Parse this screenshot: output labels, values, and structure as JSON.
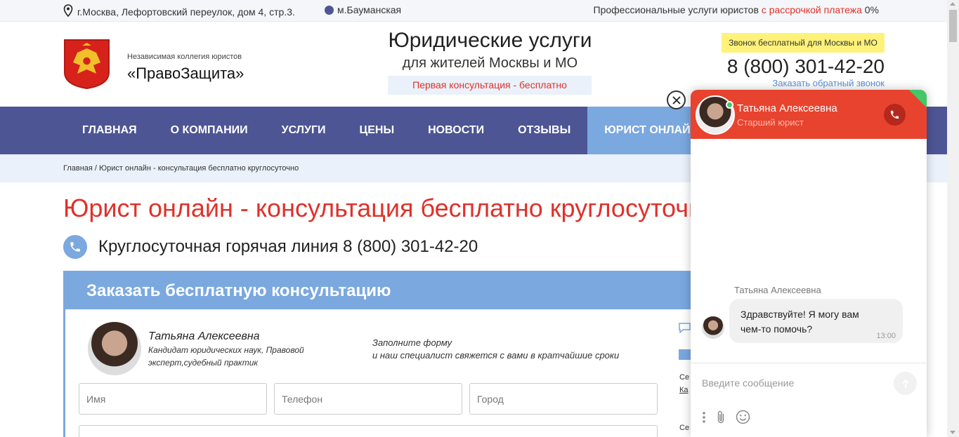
{
  "topbar": {
    "address": "г.Москва, Лефортовский переулок, дом 4, стр.3.",
    "metro": "м.Бауманская",
    "promo_prefix": "Профессиональные услуги юристов ",
    "promo_highlight": "с рассрочкой платежа",
    "promo_suffix": " 0%"
  },
  "header": {
    "org_sub": "Независимая коллегия юристов",
    "org_name": "«ПравоЗащита»",
    "title": "Юридические услуги",
    "subtitle": "для жителей Москвы и МО",
    "consult": "Первая консультация - бесплатно",
    "free_call": "Звонок бесплатный для Москвы и МО",
    "phone": "8 (800) 301-42-20",
    "callback": "Заказать обратный звонок"
  },
  "nav": {
    "items": [
      {
        "label": "ГЛАВНАЯ"
      },
      {
        "label": "О КОМПАНИИ"
      },
      {
        "label": "УСЛУГИ"
      },
      {
        "label": "ЦЕНЫ"
      },
      {
        "label": "НОВОСТИ"
      },
      {
        "label": "ОТЗЫВЫ"
      },
      {
        "label": "ЮРИСТ ОНЛАЙН"
      }
    ]
  },
  "breadcrumb": {
    "home": "Главная",
    "separator": " / ",
    "current": "Юрист онлайн - консультация бесплатно круглосуточно"
  },
  "page": {
    "title": "Юрист онлайн - консультация бесплатно круглосуточно",
    "hotline": "Круглосуточная горячая линия 8 (800) 301-42-20"
  },
  "form": {
    "heading": "Заказать бесплатную консультацию",
    "lawyer_name": "Татьяна Алексеевна",
    "lawyer_desc": "Кандидат юридических наук, Правовой эксперт,судебный практик",
    "note": "Заполните форму\nи наш специалист свяжется с вами в кратчайшие сроки",
    "name_placeholder": "Имя",
    "phone_placeholder": "Телефон",
    "city_placeholder": "Город"
  },
  "side": {
    "line1": "Се",
    "line2": "Ка",
    "line3": "Се"
  },
  "chat": {
    "agent_name": "Татьяна Алексеевна",
    "agent_role": "Старший юрист",
    "message_author": "Татьяна Алексеевна",
    "message_text": "Здравствуйте! Я могу вам чем-то помочь?",
    "message_time": "13:00",
    "input_placeholder": "Введите сообщение"
  },
  "colors": {
    "nav_bg": "#4d5594",
    "accent_blue": "#7aa8df",
    "accent_red": "#e0312a",
    "chat_header": "#e8432e",
    "online": "#44c767"
  },
  "icons": [
    "map-pin-icon",
    "metro-dot-icon",
    "emblem-icon",
    "phone-icon",
    "close-icon",
    "call-icon",
    "send-icon",
    "more-icon",
    "attach-icon",
    "emoji-icon",
    "comment-icon"
  ]
}
